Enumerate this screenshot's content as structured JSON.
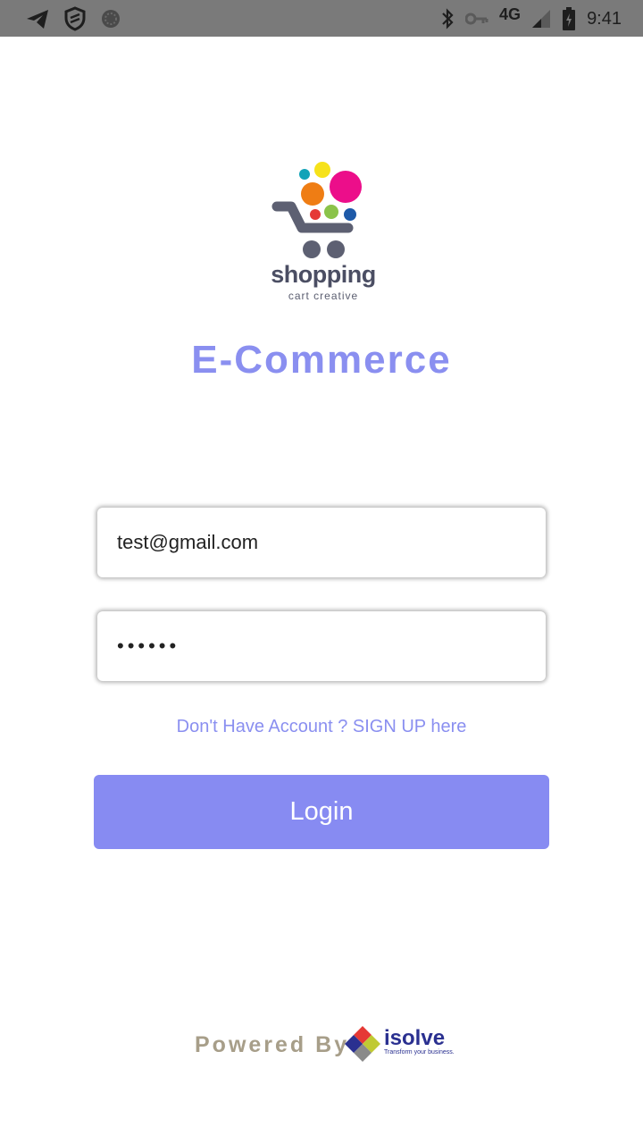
{
  "status_bar": {
    "network": "4G",
    "time": "9:41",
    "icons": [
      "telegram-icon",
      "shield-icon",
      "sync-icon",
      "bluetooth-icon",
      "key-icon",
      "signal-icon",
      "battery-icon"
    ]
  },
  "logo": {
    "word": "shopping",
    "subtitle": "cart creative",
    "colors": {
      "cyan": "#12a3b8",
      "yellow": "#f6e21a",
      "orange": "#ef7d14",
      "magenta": "#ec0e8a",
      "red": "#e53935",
      "green": "#8bc34a",
      "blue": "#1e5aa8",
      "cart": "#5d6072"
    }
  },
  "title": "E-Commerce",
  "form": {
    "email_value": "test@gmail.com",
    "password_value": "••••••",
    "signup_text": "Don't Have Account ? SIGN UP here",
    "login_label": "Login"
  },
  "footer": {
    "powered_by": "Powered By",
    "brand": "isolve",
    "brand_tagline": "Transform your business."
  },
  "colors": {
    "accent": "#878bf2",
    "title": "#8a8ff0",
    "powered_text": "#a79e89",
    "brand_blue": "#2a3090",
    "status_bar": "#7a7a7a"
  }
}
